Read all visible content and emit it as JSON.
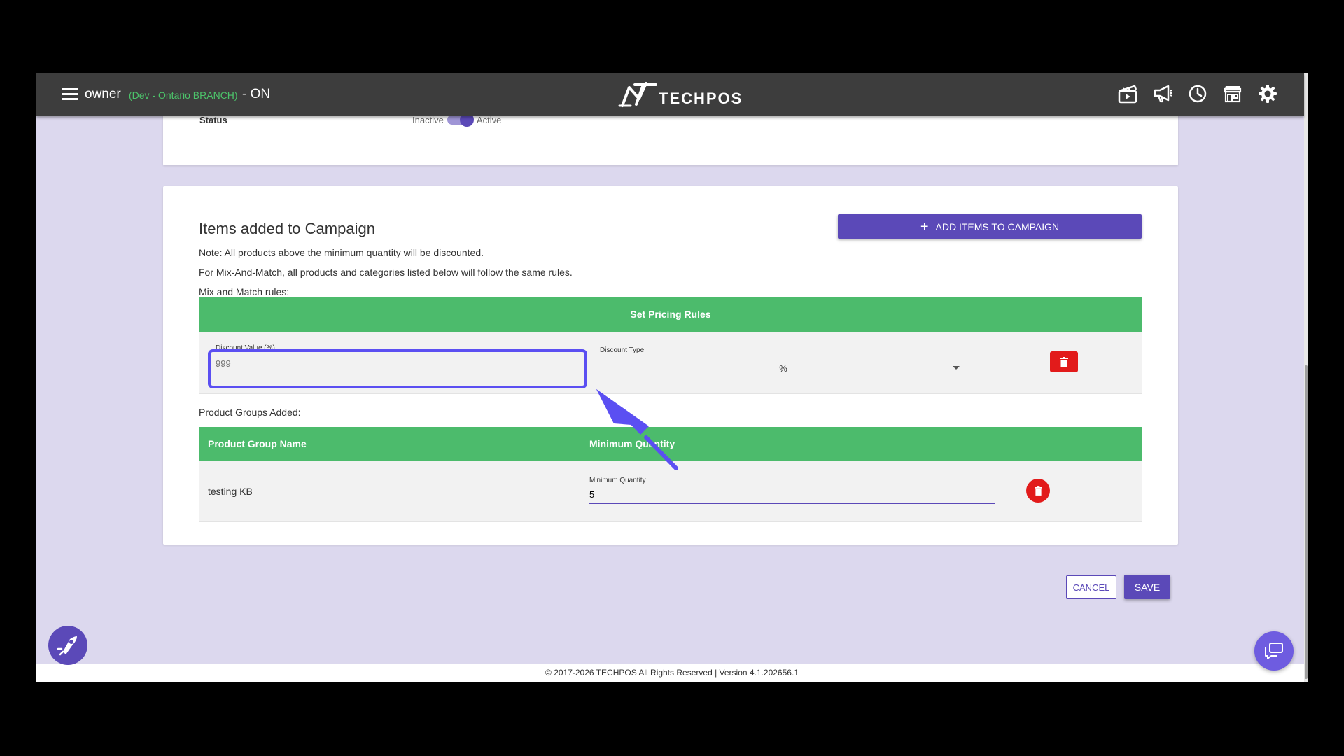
{
  "topbar": {
    "user": "owner",
    "branch": "(Dev - Ontario BRANCH)",
    "status": "- ON",
    "logo": "TECHPOS",
    "icons": [
      "clapperboard-icon",
      "megaphone-icon",
      "clock-icon",
      "store-icon",
      "gear-icon"
    ]
  },
  "status_card": {
    "label": "Status",
    "inactive": "Inactive",
    "active": "Active"
  },
  "campaign": {
    "title": "Items added to Campaign",
    "add_button": "ADD ITEMS TO CAMPAIGN",
    "note1": "Note: All products above the minimum quantity will be discounted.",
    "note2": "For Mix-And-Match, all products and categories listed below will follow the same rules.",
    "mix_label": "Mix and Match rules:",
    "pricing_header": "Set Pricing Rules",
    "discount_value_label": "Discount Value (%)",
    "discount_value_placeholder": "999",
    "discount_type_label": "Discount Type",
    "discount_type_value": "%",
    "product_groups_label": "Product Groups Added:",
    "col_group_name": "Product Group Name",
    "col_min_qty": "Minimum Quantity",
    "group_row": {
      "name": "testing KB",
      "min_qty_label": "Minimum Quantity",
      "min_qty_value": "5"
    }
  },
  "actions": {
    "cancel": "CANCEL",
    "save": "SAVE"
  },
  "footer": {
    "text": "© 2017-2026 TECHPOS All Rights Reserved | Version 4.1.202656.1"
  },
  "colors": {
    "primary": "#5b49b8",
    "header_green": "#4cbb6c",
    "danger": "#e21b1b",
    "topbar": "#3d3d3d",
    "background": "#dcd8ee",
    "annotation": "#5b4ff2"
  }
}
